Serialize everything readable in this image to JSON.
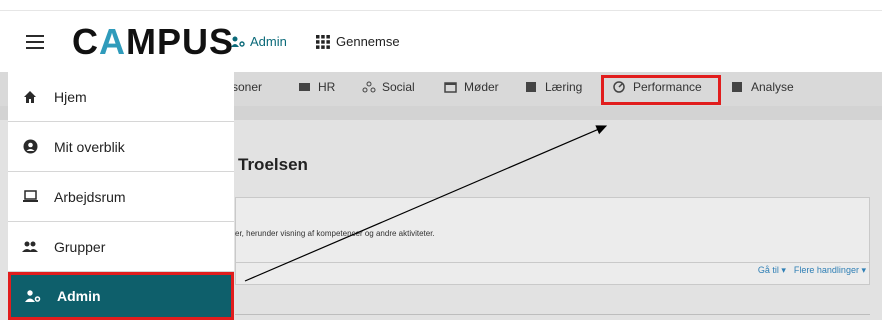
{
  "header": {
    "logo_text_pre": "C",
    "logo_text_accent": "A",
    "logo_text_post": "MPUS",
    "admin_label": "Admin",
    "browse_label": "Gennemse"
  },
  "drawer": {
    "items": [
      {
        "label": "Hjem",
        "icon": "home-icon"
      },
      {
        "label": "Mit overblik",
        "icon": "account-circle-icon"
      },
      {
        "label": "Arbejdsrum",
        "icon": "laptop-icon"
      },
      {
        "label": "Grupper",
        "icon": "group-icon"
      },
      {
        "label": "Admin",
        "icon": "user-settings-icon",
        "active": true
      }
    ]
  },
  "tabs": [
    {
      "label": "rsoner"
    },
    {
      "label": "HR"
    },
    {
      "label": "Social"
    },
    {
      "label": "Møder"
    },
    {
      "label": "Læring"
    },
    {
      "label": "Performance",
      "highlighted": true
    },
    {
      "label": "Analyse"
    }
  ],
  "main": {
    "person_title": "Troelsen",
    "card_text": "er, herunder visning af kompetencer og andre aktiviteter.",
    "goto_label": "Gå til",
    "more_actions_label": "Flere handlinger"
  },
  "colors": {
    "brand_teal": "#0e5f6b",
    "logo_accent": "#2f9bbb",
    "highlight_red": "#e11d1d",
    "link_blue": "#2f7fb5"
  }
}
